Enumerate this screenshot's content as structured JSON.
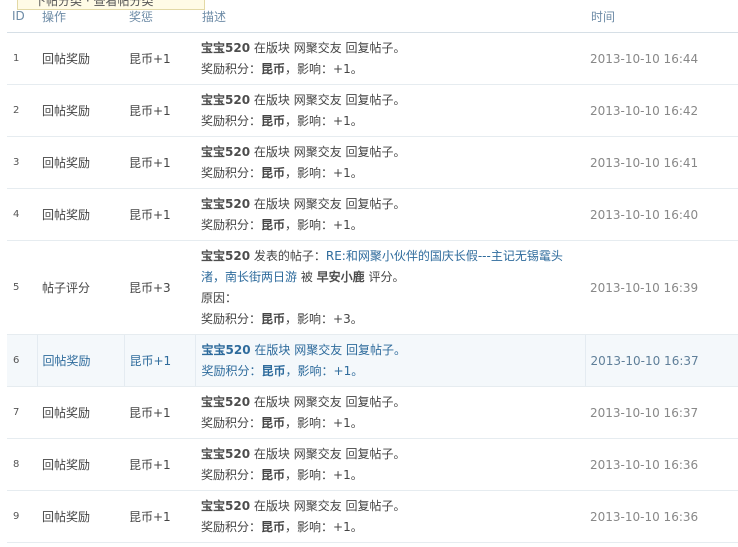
{
  "tooltip": {
    "text": "下帖分类 · 查看帖分类"
  },
  "columns": {
    "id": "ID",
    "action": "操作",
    "reward": "奖惩",
    "description": "描述",
    "time": "时间"
  },
  "labels": {
    "board_prefix": " 在版块 ",
    "reply_action": " 回复帖子。",
    "reward_points_prefix": "奖励积分：",
    "influence": "，影响：",
    "period": "。",
    "posted_prefix": " 发表的帖子：",
    "rated_by": " 被 ",
    "rated_suffix": " 评分。",
    "reason": "原因："
  },
  "rows": [
    {
      "id": "1",
      "action": "回帖奖励",
      "reward": "昆币+1",
      "user": "宝宝520",
      "board": "网聚交友",
      "currency": "昆币",
      "influence": "+1",
      "time": "2013-10-10 16:44"
    },
    {
      "id": "2",
      "action": "回帖奖励",
      "reward": "昆币+1",
      "user": "宝宝520",
      "board": "网聚交友",
      "currency": "昆币",
      "influence": "+1",
      "time": "2013-10-10 16:42"
    },
    {
      "id": "3",
      "action": "回帖奖励",
      "reward": "昆币+1",
      "user": "宝宝520",
      "board": "网聚交友",
      "currency": "昆币",
      "influence": "+1",
      "time": "2013-10-10 16:41"
    },
    {
      "id": "4",
      "action": "回帖奖励",
      "reward": "昆币+1",
      "user": "宝宝520",
      "board": "网聚交友",
      "currency": "昆币",
      "influence": "+1",
      "time": "2013-10-10 16:40"
    },
    {
      "id": "5",
      "action": "帖子评分",
      "reward": "昆币+3",
      "user": "宝宝520",
      "post_title": "RE:和网聚小伙伴的国庆长假---主记无锡鼋头渚，南长街两日游",
      "rater": "早安小鹿",
      "currency": "昆币",
      "influence": "+3",
      "time": "2013-10-10 16:39"
    },
    {
      "id": "6",
      "action": "回帖奖励",
      "reward": "昆币+1",
      "user": "宝宝520",
      "board": "网聚交友",
      "currency": "昆币",
      "influence": "+1",
      "time": "2013-10-10 16:37"
    },
    {
      "id": "7",
      "action": "回帖奖励",
      "reward": "昆币+1",
      "user": "宝宝520",
      "board": "网聚交友",
      "currency": "昆币",
      "influence": "+1",
      "time": "2013-10-10 16:37"
    },
    {
      "id": "8",
      "action": "回帖奖励",
      "reward": "昆币+1",
      "user": "宝宝520",
      "board": "网聚交友",
      "currency": "昆币",
      "influence": "+1",
      "time": "2013-10-10 16:36"
    },
    {
      "id": "9",
      "action": "回帖奖励",
      "reward": "昆币+1",
      "user": "宝宝520",
      "board": "网聚交友",
      "currency": "昆币",
      "influence": "+1",
      "time": "2013-10-10 16:36"
    }
  ]
}
